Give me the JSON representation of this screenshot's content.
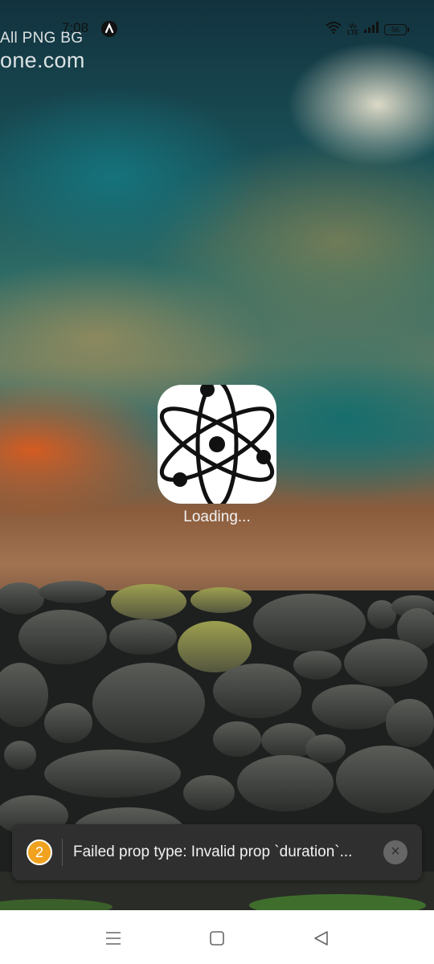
{
  "status_bar": {
    "time": "7:08",
    "battery_level": "56",
    "network_label": "Vo LTE",
    "icons": [
      "wifi-icon",
      "volte-icon",
      "signal-icon",
      "battery-icon"
    ]
  },
  "watermark": {
    "line1": "All PNG BG",
    "line2": "one.com"
  },
  "splash": {
    "icon": "atom-icon",
    "loading_text": "Loading..."
  },
  "toast": {
    "count": "2",
    "message": "Failed prop type: Invalid prop `duration`...",
    "close_icon": "close-icon",
    "accent_color": "#f0a21f"
  },
  "nav_bar": {
    "buttons": [
      "menu-icon",
      "home-icon",
      "back-icon"
    ]
  }
}
